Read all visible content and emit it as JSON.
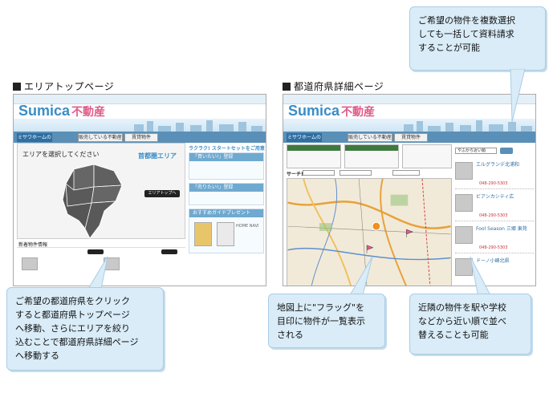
{
  "headings": {
    "left": "エリアトップページ",
    "right": "都道府県詳細ページ"
  },
  "callouts": {
    "top_right": [
      "ご希望の物件を複数選択",
      "しても一括して資料請求",
      "することが可能"
    ],
    "bottom_left": [
      "ご希望の都道府県をクリック",
      "すると都道府県トップページ",
      "へ移動、さらにエリアを絞り",
      "込むことで都道府県詳細ページ",
      "へ移動する"
    ],
    "bottom_middle": [
      "地図上に\"フラッグ\"を",
      "目印に物件が一覧表示",
      "される"
    ],
    "bottom_right": [
      "近隣の物件を駅や学校",
      "などから近い順で並べ",
      "替えることも可能"
    ]
  },
  "screenshot_left": {
    "logo": "Sumica",
    "logo_suffix": "不動産",
    "tabs": [
      "ミサワホームの不動産情報",
      "販売している不動産",
      "賃貸物件"
    ],
    "area_prompt": "エリアを選択してください",
    "region_label": "首都圏エリア",
    "area_button": "エリアトップへ",
    "new_listings": "新着物件情報",
    "side_title": "ラクラク! スタートセットをご用意",
    "side_head_1": "「買いたい!」登録",
    "side_head_2": "「売りたい!」登録",
    "side_head_3": "おすすめガイドプレゼント",
    "guide_label": "HOME NAVI"
  },
  "screenshot_right": {
    "logo": "Sumica",
    "logo_suffix": "不動産",
    "tabs": [
      "ミサワホームの不動産情報",
      "販売している不動産",
      "賃貸物件"
    ],
    "search_label": "サーチ!",
    "sort_label": "やふから近い順",
    "listing_titles": [
      "エルグランデ北浦和",
      "ビアンカシティ広",
      "Fool Season 三郷 東苑",
      "ドーノ小峰北県"
    ],
    "listing_price": "048-290-5303"
  },
  "colors": {
    "callout_bg": "#d9ecf8",
    "brand_blue": "#3a8dc6",
    "nav_blue": "#5a8fb7"
  }
}
